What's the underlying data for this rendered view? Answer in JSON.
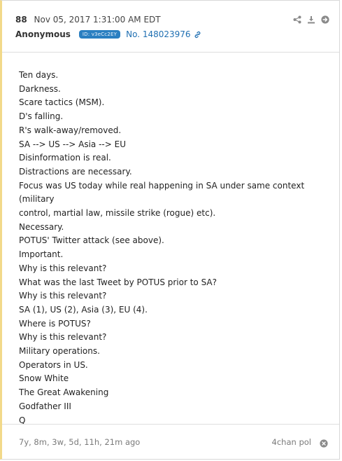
{
  "post": {
    "number": "88",
    "date": "Nov 05, 2017 1:31:00 AM EDT",
    "author": "Anonymous",
    "id_badge": "ID: v3eCc2EY",
    "post_number": "No. 148023976"
  },
  "toolbar": {
    "share_icon": "share-icon",
    "download_icon": "download-icon",
    "forward_icon": "arrow-right-circle-icon"
  },
  "body_lines": [
    "Ten days.",
    "Darkness.",
    "Scare tactics (MSM).",
    "D's falling.",
    "R's walk-away/removed.",
    "SA --> US --> Asia --> EU",
    "Disinformation is real.",
    "Distractions are necessary.",
    "Focus was US today while real happening in SA under same context (military",
    "control, martial law, missile strike (rogue) etc).",
    "Necessary.",
    "POTUS' Twitter attack (see above).",
    "Important.",
    "Why is this relevant?",
    "What was the last Tweet by POTUS prior to SA?",
    "Why is this relevant?",
    "SA (1), US (2), Asia (3), EU (4).",
    "Where is POTUS?",
    "Why is this relevant?",
    "Military operations.",
    "Operators in US.",
    "Snow White",
    "The Great Awakening",
    "Godfather III",
    "Q"
  ],
  "footer": {
    "age": "7y, 8m, 3w, 5d, 11h, 21m ago",
    "source": "4chan pol"
  },
  "colors": {
    "accent_border": "#f2d98a",
    "badge": "#2a7fc1",
    "link": "#1f6fb2"
  }
}
